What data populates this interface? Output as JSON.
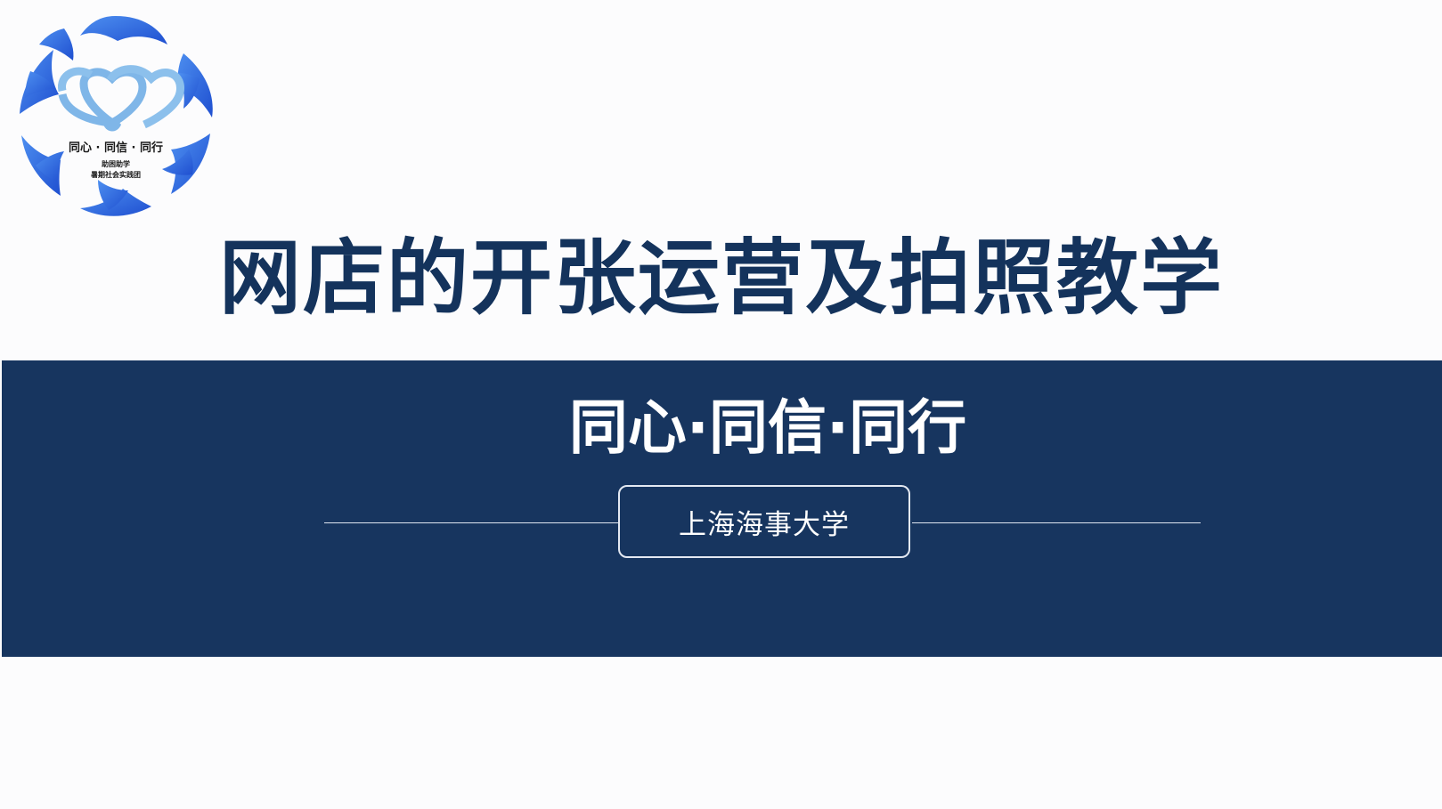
{
  "slide": {
    "title": "网店的开张运营及拍照教学",
    "slogan": "同心·同信·同行",
    "organization": "上海海事大学"
  },
  "logo": {
    "icon": "heart-logo-icon",
    "text_line1": "同心 · 同信 · 同行",
    "text_line2": "助困助学",
    "text_line3": "暑期社会实践团"
  },
  "colors": {
    "title": "#14335c",
    "banner": "#17355f",
    "logo_blue": "#2b5fd9",
    "logo_light": "#7fb6e8",
    "background": "#fcfcfd"
  }
}
